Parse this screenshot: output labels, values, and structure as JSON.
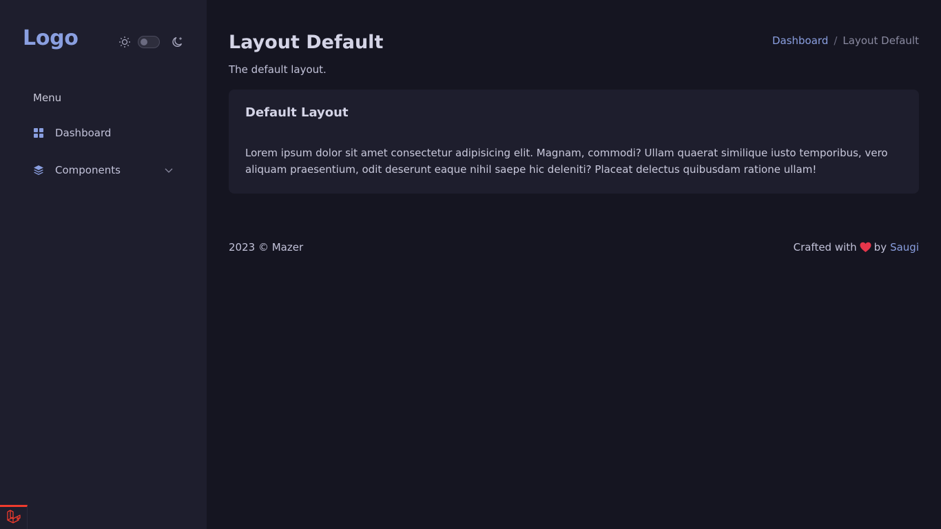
{
  "sidebar": {
    "logo": "Logo",
    "theme": {
      "light_icon": "sun-icon",
      "dark_icon": "moon-icon",
      "dark_mode_on": false
    },
    "menu_title": "Menu",
    "items": [
      {
        "label": "Dashboard",
        "icon": "grid-icon"
      },
      {
        "label": "Components",
        "icon": "stack-icon",
        "has_submenu": true
      }
    ]
  },
  "header": {
    "title": "Layout Default",
    "subtitle": "The default layout.",
    "breadcrumb": {
      "link": "Dashboard",
      "separator": "/",
      "active": "Layout Default"
    }
  },
  "card": {
    "title": "Default Layout",
    "body": "Lorem ipsum dolor sit amet consectetur adipisicing elit. Magnam, commodi? Ullam quaerat similique iusto temporibus, vero aliquam praesentium, odit deserunt eaque nihil saepe hic deleniti? Placeat delectus quibusdam ratione ullam!"
  },
  "footer": {
    "copyright": "2023 © Mazer",
    "crafted_prefix": "Crafted with",
    "crafted_by": "by",
    "author": "Saugi"
  },
  "colors": {
    "accent": "#8a9fe0",
    "heart": "#e5364b",
    "laravel": "#ef3b2d"
  }
}
